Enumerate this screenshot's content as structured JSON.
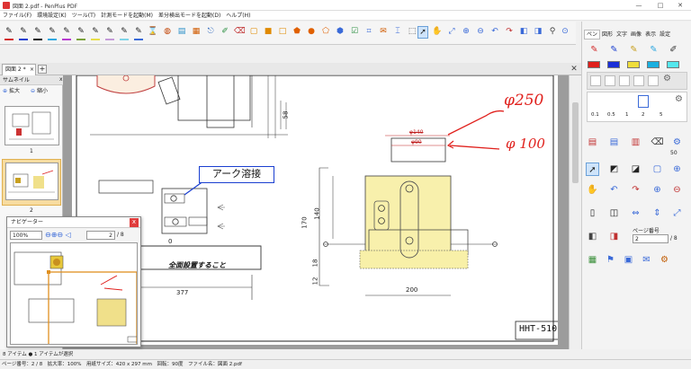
{
  "window": {
    "title": "図面 2.pdf - PenPlus PDF",
    "minimize": "—",
    "maximize": "□",
    "close": "✕"
  },
  "menu": [
    "ファイル(F)",
    "環境設定(K)",
    "ツール(T)",
    "計測モードを起動(M)",
    "差分検出モードを起動(D)",
    "ヘルプ(H)"
  ],
  "toolbar": {
    "pens": [
      {
        "icon": "pen-icon",
        "color": "#d32a2a"
      },
      {
        "icon": "pen-icon",
        "color": "#1a3fd0"
      },
      {
        "icon": "pen-icon",
        "color": "#111111"
      },
      {
        "icon": "pen-icon",
        "color": "#2fa8e0"
      },
      {
        "icon": "pen-icon",
        "color": "#b73bd0"
      },
      {
        "icon": "pen-icon",
        "color": "#7aa23a"
      },
      {
        "icon": "highlighter-icon",
        "color": "#e8de4a"
      },
      {
        "icon": "highlighter-icon",
        "color": "#c49ad8"
      },
      {
        "icon": "highlighter-icon",
        "color": "#7ed4e8"
      }
    ]
  },
  "tabs": {
    "doc_tab": "図面 2 *",
    "close": "×",
    "plus": "+",
    "panel_close": "✕"
  },
  "thumbnails": {
    "title": "サムネイル",
    "zoom_in": "拡大",
    "zoom_out": "縮小",
    "pages": [
      "1",
      "2"
    ]
  },
  "navigator": {
    "title": "ナビゲーター",
    "zoom": "100%",
    "page": "2",
    "page_total": "/ 8",
    "close": "x"
  },
  "drawing": {
    "callout": "アーク溶接",
    "note": "全面設置すること",
    "title_block": "HHT-510",
    "dims": {
      "d58": "58",
      "d377": "377",
      "d140": "140",
      "d170": "170",
      "d18": "18",
      "d12": "12",
      "d200": "200",
      "d0": "0",
      "phi140": "φ140",
      "phi90": "φ90"
    },
    "handwriting": [
      "φ250",
      "φ 100"
    ]
  },
  "right_panel": {
    "tabs": [
      "ペン",
      "図形",
      "文字",
      "画像",
      "表示",
      "設定"
    ],
    "swatches": [
      "#e0201c",
      "#1a2fd8",
      "#f0de3c",
      "#1ab0e0",
      "#c8c8c8",
      "#55e8ee"
    ],
    "widths": [
      "0.1",
      "0.5",
      "1",
      "2",
      "5"
    ],
    "value_50": "50",
    "page_label": "ページ番号",
    "page_value": "2",
    "page_total": "/ 8"
  },
  "status": {
    "text": "ページ番号：2 / 8　拡大率：100%　用紙サイズ：420 x 297 mm　回転：90度　ファイル名：図面 2.pdf",
    "left_tabs": "8 アイテム  ● 1 アイテムが選択"
  }
}
